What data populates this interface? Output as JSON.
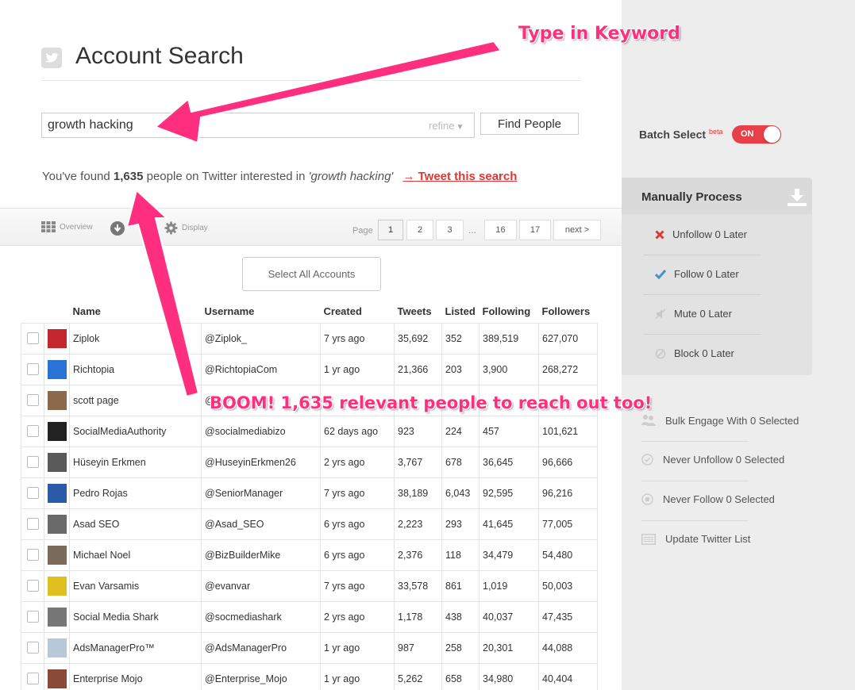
{
  "header": {
    "title": "Account Search"
  },
  "search": {
    "value": "growth hacking",
    "refine_label": "refine",
    "find_button": "Find People"
  },
  "results": {
    "prefix": "You've found",
    "count": "1,635",
    "middle": "people on Twitter interested in",
    "query": "'growth hacking'",
    "tweet_link": "→ Tweet this search"
  },
  "toolbar": {
    "overview": "Overview",
    "display": "Display",
    "page_label": "Page",
    "pages": [
      "1",
      "2",
      "3",
      "16",
      "17"
    ],
    "ellipsis": "...",
    "next": "next >"
  },
  "select_all": "Select All Accounts",
  "table": {
    "headers": [
      "Name",
      "Username",
      "Created",
      "Tweets",
      "Listed",
      "Following",
      "Followers"
    ],
    "rows": [
      [
        "Ziplok",
        "@Ziplok_",
        "7 yrs ago",
        "35,692",
        "352",
        "389,519",
        "627,070"
      ],
      [
        "Richtopia",
        "@RichtopiaCom",
        "1 yr ago",
        "21,366",
        "203",
        "3,900",
        "268,272"
      ],
      [
        "scott page",
        "@",
        "",
        "",
        "",
        "",
        ""
      ],
      [
        "SocialMediaAuthority",
        "@socialmediabizo",
        "62 days ago",
        "923",
        "224",
        "457",
        "101,621"
      ],
      [
        "Hüseyin Erkmen",
        "@HuseyinErkmen26",
        "2 yrs ago",
        "3,767",
        "678",
        "36,645",
        "96,666"
      ],
      [
        "Pedro Rojas",
        "@SeniorManager",
        "7 yrs ago",
        "38,189",
        "6,043",
        "92,595",
        "96,216"
      ],
      [
        "Asad SEO",
        "@Asad_SEO",
        "6 yrs ago",
        "2,223",
        "293",
        "41,645",
        "77,005"
      ],
      [
        "Michael Noel",
        "@BizBuilderMike",
        "6 yrs ago",
        "2,376",
        "118",
        "34,479",
        "54,480"
      ],
      [
        "Evan Varsamis",
        "@evanvar",
        "7 yrs ago",
        "33,578",
        "861",
        "1,019",
        "50,003"
      ],
      [
        "Social Media Shark",
        "@socmediashark",
        "2 yrs ago",
        "1,178",
        "438",
        "40,037",
        "47,435"
      ],
      [
        "AdsManagerPro™",
        "@AdsManagerPro",
        "1 yr ago",
        "987",
        "258",
        "20,301",
        "44,088"
      ],
      [
        "Enterprise Mojo",
        "@Enterprise_Mojo",
        "1 yr ago",
        "5,262",
        "658",
        "34,980",
        "40,404"
      ]
    ]
  },
  "sidebar": {
    "batch_select": "Batch Select",
    "beta": "beta",
    "toggle": "ON",
    "manual": {
      "title": "Manually Process",
      "items": [
        "Unfollow 0 Later",
        "Follow 0 Later",
        "Mute 0 Later",
        "Block 0 Later"
      ]
    },
    "actions": [
      "Bulk Engage With 0 Selected",
      "Never Unfollow 0 Selected",
      "Never Follow 0 Selected",
      "Update Twitter List"
    ]
  },
  "annotations": {
    "keyword": "Type in Keyword",
    "boom": "BOOM! 1,635 relevant people to reach out too!"
  },
  "colors": {
    "accent": "#e23534",
    "toggle": "#e8404a",
    "annotation": "#ff2e7e",
    "sidebar_bg": "#ededed"
  }
}
